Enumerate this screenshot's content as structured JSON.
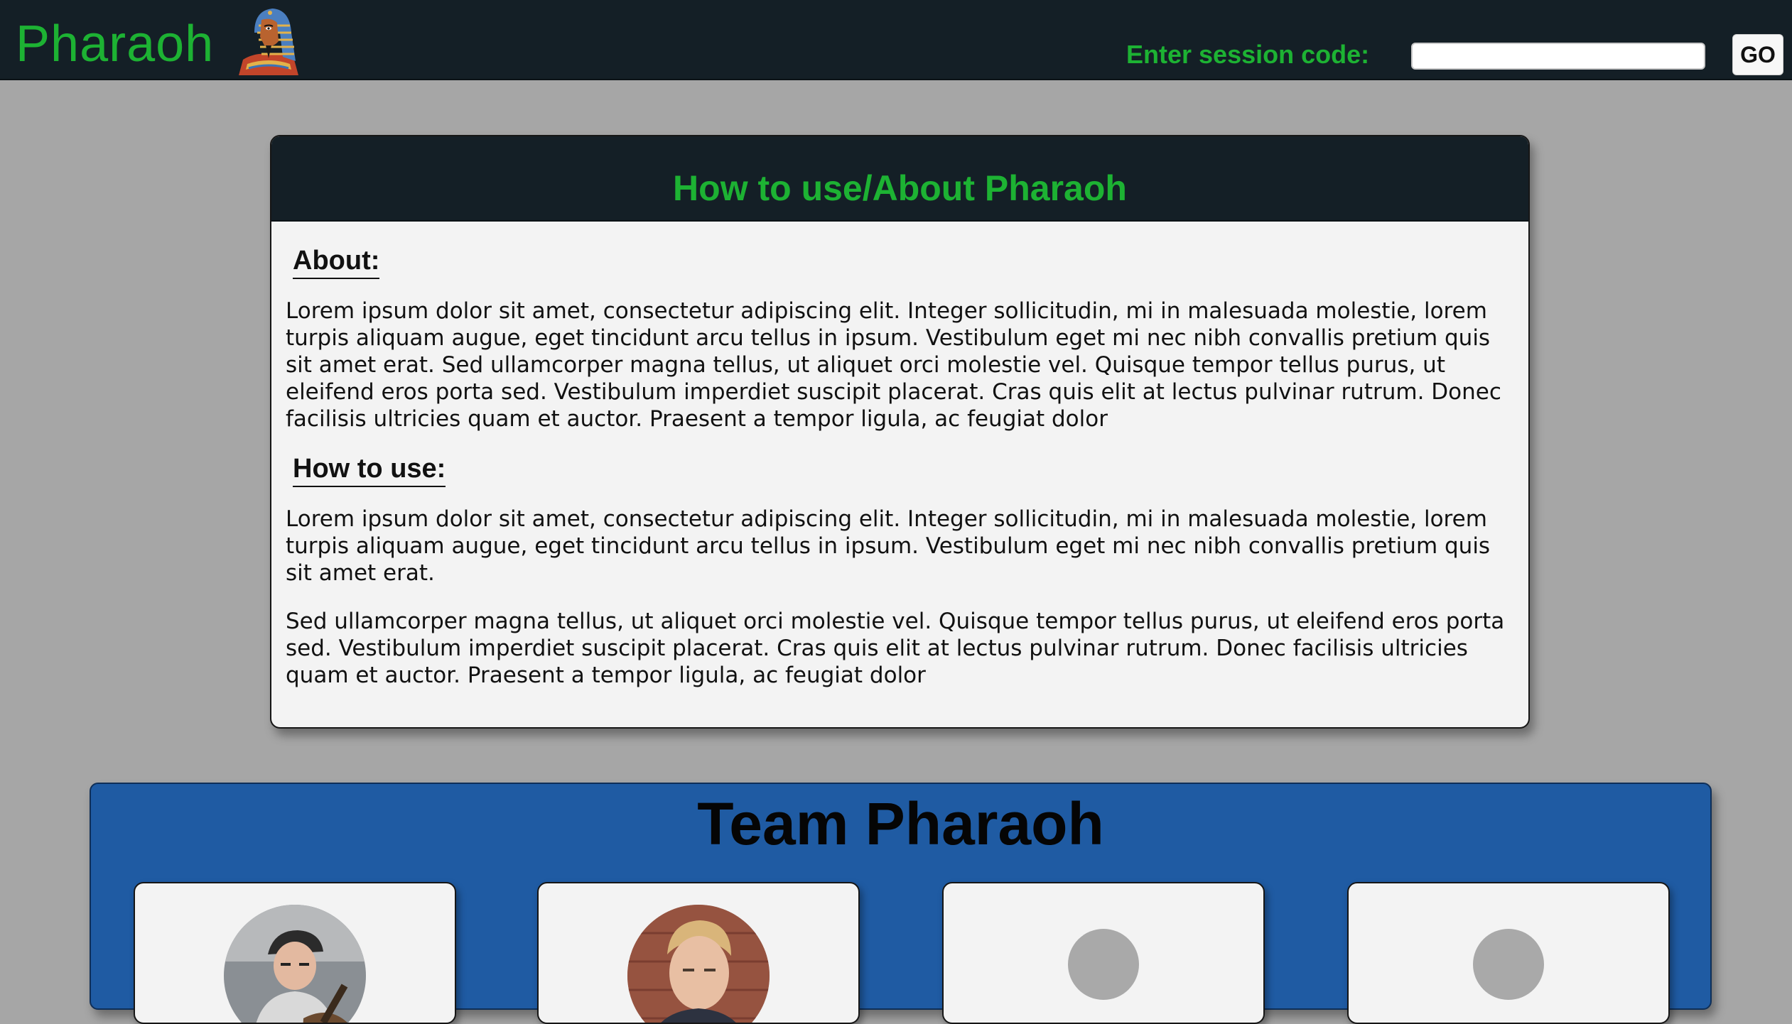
{
  "header": {
    "brand": "Pharaoh",
    "logo_icon": "pharaoh-icon",
    "session_label": "Enter session code:",
    "session_input_value": "",
    "go_label": "GO",
    "colors": {
      "bar": "#141f26",
      "accent": "#1db233"
    }
  },
  "about": {
    "title": "How to use/About Pharaoh",
    "about_heading": "About:",
    "about_text": "Lorem ipsum dolor sit amet, consectetur adipiscing elit. Integer sollicitudin, mi in malesuada molestie, lorem turpis aliquam augue, eget tincidunt arcu tellus in ipsum. Vestibulum eget mi nec nibh convallis pretium quis sit amet erat. Sed ullamcorper magna tellus, ut aliquet orci molestie vel. Quisque tempor tellus purus, ut eleifend eros porta sed. Vestibulum imperdiet suscipit placerat. Cras quis elit at lectus pulvinar rutrum. Donec facilisis ultricies quam et auctor. Praesent a tempor ligula, ac feugiat dolor",
    "howto_heading": "How to use:",
    "howto_text_1": "Lorem ipsum dolor sit amet, consectetur adipiscing elit. Integer sollicitudin, mi in malesuada molestie, lorem turpis aliquam augue, eget tincidunt arcu tellus in ipsum. Vestibulum eget mi nec nibh convallis pretium quis sit amet erat.",
    "howto_text_2": "Sed ullamcorper magna tellus, ut aliquet orci molestie vel. Quisque tempor tellus purus, ut eleifend eros porta sed. Vestibulum imperdiet suscipit placerat. Cras quis elit at lectus pulvinar rutrum. Donec facilisis ultricies quam et auctor. Praesent a tempor ligula, ac feugiat dolor"
  },
  "team": {
    "title": "Team Pharaoh",
    "section_color": "#1f5ba3",
    "members": [
      {
        "avatar": "member-photo-guitarist"
      },
      {
        "avatar": "member-photo-blond"
      },
      {
        "avatar": "avatar-placeholder"
      },
      {
        "avatar": "avatar-placeholder"
      }
    ]
  }
}
